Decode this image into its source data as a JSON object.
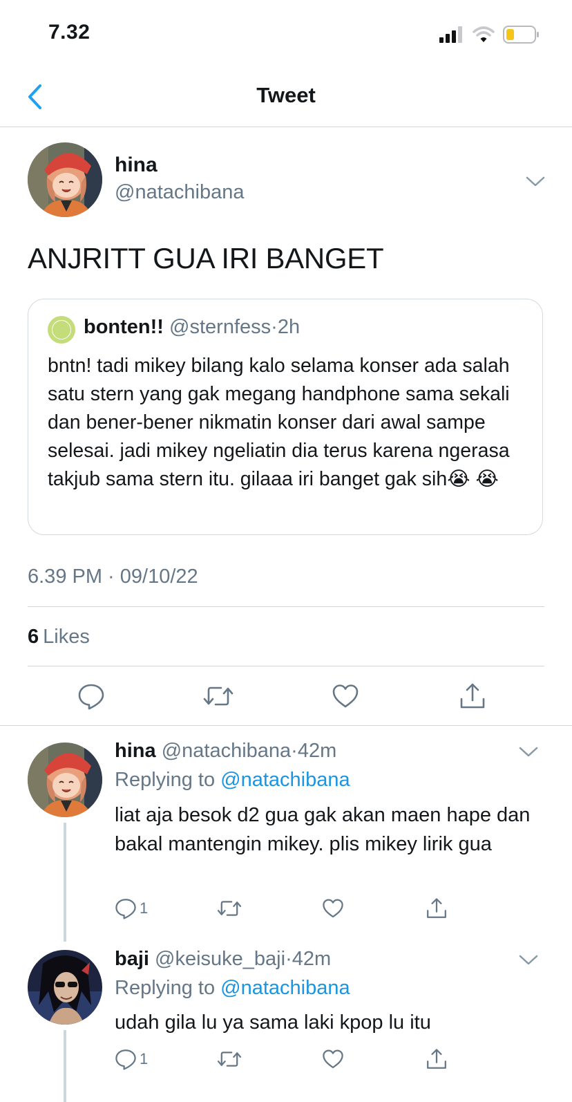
{
  "status_bar": {
    "time": "7.32"
  },
  "nav": {
    "title": "Tweet"
  },
  "main_tweet": {
    "name": "hina",
    "handle": "@natachibana",
    "text": "ANJRITT GUA IRI BANGET",
    "quote": {
      "name": "bonten!!",
      "handle": "@sternfess",
      "separator": "·",
      "time": "2h",
      "body": "bntn! tadi mikey bilang kalo selama konser ada salah satu stern yang gak megang handphone sama sekali dan bener-bener nikmatin konser dari awal sampe selesai. jadi mikey ngeliatin dia terus karena ngerasa takjub sama stern itu. gilaaa iri banget gak sih😭 😭"
    },
    "timestamp": "6.39 PM · 09/10/22",
    "likes_count": "6",
    "likes_label": "Likes"
  },
  "replies": [
    {
      "name": "hina",
      "handle": "@natachibana",
      "separator": "·",
      "time": "42m",
      "replying_prefix": "Replying to",
      "replying_to": "@natachibana",
      "text": "liat aja besok d2 gua gak akan maen hape dan bakal mantengin mikey. plis mikey lirik gua",
      "reply_count": "1"
    },
    {
      "name": "baji",
      "handle": "@keisuke_baji",
      "separator": "·",
      "time": "42m",
      "replying_prefix": "Replying to",
      "replying_to": "@natachibana",
      "text": "udah gila lu ya sama laki kpop lu itu",
      "reply_count": "1"
    }
  ],
  "colors": {
    "accent": "#1b95e0",
    "secondary_text": "#657786",
    "divider": "#cfd6dc"
  },
  "icons": [
    "back-chevron-icon",
    "chevron-down-icon",
    "reply-icon",
    "retweet-icon",
    "like-icon",
    "share-icon",
    "signal-icon",
    "wifi-icon",
    "battery-icon"
  ]
}
